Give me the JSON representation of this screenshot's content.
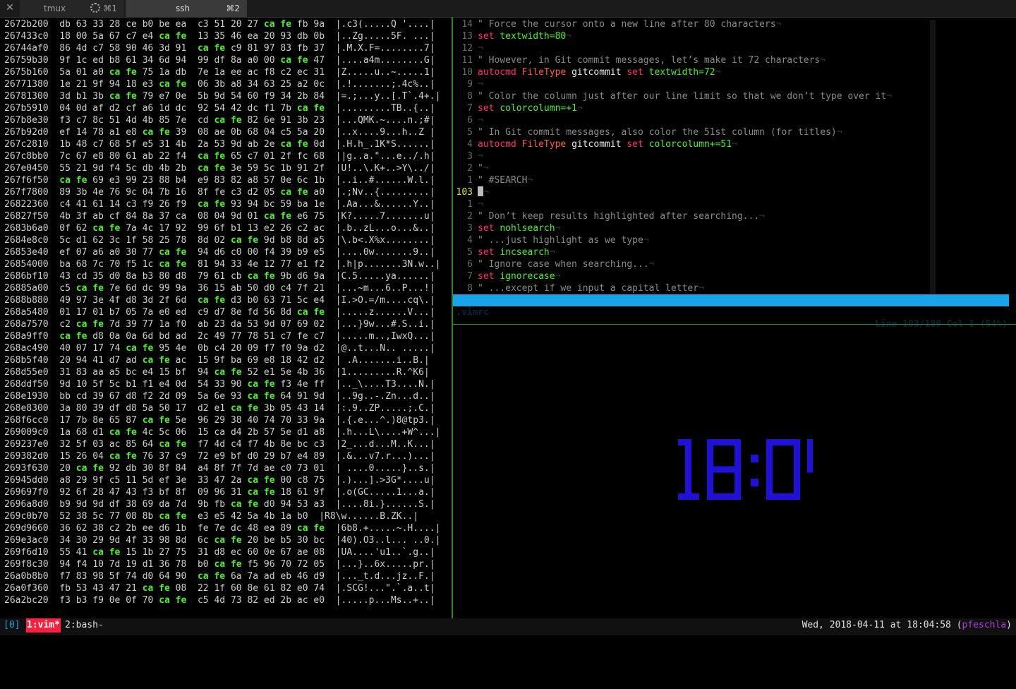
{
  "tabs": [
    {
      "title": "tmux",
      "shortcut": "⌘1",
      "busy": true
    },
    {
      "title": "ssh",
      "shortcut": "⌘2",
      "busy": false
    }
  ],
  "hexdump": [
    {
      "addr": "2672b200",
      "h1": "db 63 33 28 ce b0 be ea",
      "h2": "c3 51 20 27 ca fe fb 9a",
      "ascii": "|.c3(.....Q '....|"
    },
    {
      "addr": "267433c0",
      "h1": "18 00 5a 67 c7 e4 ca fe",
      "h2": "13 35 46 ea 20 93 db 0b",
      "ascii": "|..Zg.....5F. ...|"
    },
    {
      "addr": "26744af0",
      "h1": "86 4d c7 58 90 46 3d 91",
      "h2": "ca fe c9 81 97 83 fb 37",
      "ascii": "|.M.X.F=........7|"
    },
    {
      "addr": "26759b30",
      "h1": "9f 1c ed b8 61 34 6d 94",
      "h2": "99 df 8a a0 00 ca fe 47",
      "ascii": "|....a4m........G|"
    },
    {
      "addr": "2675b160",
      "h1": "5a 01 a0 ca fe 75 1a db",
      "h2": "7e 1a ee ac f8 c2 ec 31",
      "ascii": "|Z.....u..~.....1|"
    },
    {
      "addr": "26771380",
      "h1": "1e 21 9f 94 18 e3 ca fe",
      "h2": "06 3b a8 34 63 25 a2 0c",
      "ascii": "|.!.......;.4c%..|"
    },
    {
      "addr": "26781300",
      "h1": "3d b1 3b ca fe 79 e7 0e",
      "h2": "5b 9d 54 60 f9 34 2b 84",
      "ascii": "|=.;...y..[.T`.4+.|"
    },
    {
      "addr": "267b5910",
      "h1": "04 0d af d2 cf a6 1d dc",
      "h2": "92 54 42 dc f1 7b ca fe",
      "ascii": "|.........TB..{..|"
    },
    {
      "addr": "267b8e30",
      "h1": "f3 c7 8c 51 4d 4b 85 7e",
      "h2": "cd ca fe 82 6e 91 3b 23",
      "ascii": "|...QMK.~....n.;#|"
    },
    {
      "addr": "267b92d0",
      "h1": "ef 14 78 a1 e8 ca fe 39",
      "h2": "08 ae 0b 68 04 c5 5a 20",
      "ascii": "|..x....9...h..Z |"
    },
    {
      "addr": "267c2810",
      "h1": "1b 48 c7 68 5f e5 31 4b",
      "h2": "2a 53 9d ab 2e ca fe 0d",
      "ascii": "|.H.h_.1K*S......|"
    },
    {
      "addr": "267c8bb0",
      "h1": "7c 67 e8 80 61 ab 22 f4",
      "h2": "ca fe 65 c7 01 2f fc 68",
      "ascii": "||g..a.\"...e../.h|"
    },
    {
      "addr": "267e0450",
      "h1": "55 21 9d f4 5c db 4b 2b",
      "h2": "ca fe 3e 59 5c 1b 91 2f",
      "ascii": "|U!..\\.K+..>Y\\../|"
    },
    {
      "addr": "267f6f50",
      "h1": "ca fe 69 e3 99 23 88 b4",
      "h2": "e9 83 82 a8 57 0e 6c 1b",
      "ascii": "|..i..#......W.l.|"
    },
    {
      "addr": "267f7800",
      "h1": "89 3b 4e 76 9c 04 7b 16",
      "h2": "8f fe c3 d2 05 ca fe a0",
      "ascii": "|.;Nv..{.........|"
    },
    {
      "addr": "26822360",
      "h1": "c4 41 61 14 c3 f9 26 f9",
      "h2": "ca fe 93 94 bc 59 ba 1e",
      "ascii": "|.Aa...&......Y..|"
    },
    {
      "addr": "26827f50",
      "h1": "4b 3f ab cf 84 8a 37 ca",
      "h2": "08 04 9d 01 ca fe e6 75",
      "ascii": "|K?.....7.......u|"
    },
    {
      "addr": "2683b6a0",
      "h1": "0f 62 ca fe 7a 4c 17 92",
      "h2": "99 6f b1 13 e2 26 c2 ac",
      "ascii": "|.b..zL...o...&..|"
    },
    {
      "addr": "2684e8c0",
      "h1": "5c d1 62 3c 1f 58 25 78",
      "h2": "8d 02 ca fe 9d b8 8d a5",
      "ascii": "|\\.b<.X%x........|"
    },
    {
      "addr": "26853e40",
      "h1": "ef 07 a6 a0 30 77 ca fe",
      "h2": "94 d6 c0 00 f4 39 b9 e5",
      "ascii": "|....0w.......9..|"
    },
    {
      "addr": "26854000",
      "h1": "ba 68 7c 70 f5 1c ca fe",
      "h2": "81 94 33 4e 12 77 e1 f2",
      "ascii": "|.h|p.......3N.w..|"
    },
    {
      "addr": "2686bf10",
      "h1": "43 cd 35 d0 8a b3 80 d8",
      "h2": "79 61 cb ca fe 9b d6 9a",
      "ascii": "|C.5.....ya......|"
    },
    {
      "addr": "26885a00",
      "h1": "c5 ca fe 7e 6d dc 99 9a",
      "h2": "36 15 ab 50 d0 c4 7f 21",
      "ascii": "|...~m...6..P...!|"
    },
    {
      "addr": "2688b880",
      "h1": "49 97 3e 4f d8 3d 2f 6d",
      "h2": "ca fe d3 b0 63 71 5c e4",
      "ascii": "|I.>O.=/m....cq\\.|"
    },
    {
      "addr": "268a5480",
      "h1": "01 17 01 b7 05 7a e0 ed",
      "h2": "c9 d7 8e fd 56 8d ca fe",
      "ascii": "|.....z......V...|"
    },
    {
      "addr": "268a7570",
      "h1": "c2 ca fe 7d 39 77 1a f0",
      "h2": "ab 23 da 53 9d 07 69 02",
      "ascii": "|...}9w...#.S..i.|"
    },
    {
      "addr": "268a9ff0",
      "h1": "ca fe d8 0a 0a 6d bd ad",
      "h2": "2c 49 77 78 51 c7 fe c7",
      "ascii": "|.....m..,IwxQ...|"
    },
    {
      "addr": "268ac490",
      "h1": "40 07 17 74 ca fe 95 4e",
      "h2": "0b c4 20 09 f7 f0 9a d2",
      "ascii": "|@..t...N.. .....|"
    },
    {
      "addr": "268b5f40",
      "h1": "20 94 41 d7 ad ca fe ac",
      "h2": "15 9f ba 69 e8 18 42 d2",
      "ascii": "| .A.......i..B.|"
    },
    {
      "addr": "268d55e0",
      "h1": "31 83 aa a5 bc e4 15 bf",
      "h2": "94 ca fe 52 e1 5e 4b 36",
      "ascii": "|1.........R.^K6|"
    },
    {
      "addr": "268ddf50",
      "h1": "9d 10 5f 5c b1 f1 e4 0d",
      "h2": "54 33 90 ca fe f3 4e ff",
      "ascii": "|.._\\....T3....N.|"
    },
    {
      "addr": "268e1930",
      "h1": "bb cd 39 67 d8 f2 2d 09",
      "h2": "5a 6e 93 ca fe 64 91 9d",
      "ascii": "|..9g..-.Zn...d..|"
    },
    {
      "addr": "268e8300",
      "h1": "3a 80 39 df d8 5a 50 17",
      "h2": "d2 e1 ca fe 3b 05 43 14",
      "ascii": "|:.9..ZP.....;.C.|"
    },
    {
      "addr": "268f6cc0",
      "h1": "17 7b 8e 65 87 ca fe 5e",
      "h2": "96 29 38 40 74 70 33 9a",
      "ascii": "|.{.e...^.)8@tp3.|"
    },
    {
      "addr": "269009c0",
      "h1": "1a 68 d1 ca fe 4c 5c 06",
      "h2": "15 ca d4 2b 57 5e d1 a8",
      "ascii": "|.h...L\\....+W^...|"
    },
    {
      "addr": "269237e0",
      "h1": "32 5f 03 ac 85 64 ca fe",
      "h2": "f7 4d c4 f7 4b 8e bc c3",
      "ascii": "|2_...d...M..K...|"
    },
    {
      "addr": "269382d0",
      "h1": "15 26 04 ca fe 76 37 c9",
      "h2": "72 e9 bf d0 29 b7 e4 89",
      "ascii": "|.&...v7.r...)...|"
    },
    {
      "addr": "2693f630",
      "h1": "20 ca fe 92 db 30 8f 84",
      "h2": "a4 8f 7f 7d ae c0 73 01",
      "ascii": "| ....0.....}..s.|"
    },
    {
      "addr": "26945dd0",
      "h1": "a8 29 9f c5 11 5d ef 3e",
      "h2": "33 47 2a ca fe 00 c8 75",
      "ascii": "|.)...].>3G*....u|"
    },
    {
      "addr": "269697f0",
      "h1": "92 6f 28 47 43 f3 bf 8f",
      "h2": "09 96 31 ca fe 18 61 9f",
      "ascii": "|.o(GC.....1...a.|"
    },
    {
      "addr": "2696a8d0",
      "h1": "b9 9d 9d df 38 69 da 7d",
      "h2": "9b fb ca fe d0 94 53 a3",
      "ascii": "|....8i.}......S.|"
    },
    {
      "addr": "269c0b70",
      "h1": "52 38 5c 77 08 8b ca fe",
      "h2": "e3 e5 42 5a 4b 1a b0",
      "ascii": "|R8\\w......B.ZK..|"
    },
    {
      "addr": "269d9660",
      "h1": "36 62 38 c2 2b ee d6 1b",
      "h2": "fe 7e dc 48 ea 89 ca fe",
      "ascii": "|6b8.+.....~.H....|"
    },
    {
      "addr": "269e3ac0",
      "h1": "34 30 29 9d 4f 33 98 8d",
      "h2": "6c ca fe 20 be b5 30 bc",
      "ascii": "|40).O3..l... ..0.|"
    },
    {
      "addr": "269f6d10",
      "h1": "55 41 ca fe 15 1b 27 75",
      "h2": "31 d8 ec 60 0e 67 ae 08",
      "ascii": "|UA....'u1..`.g..|"
    },
    {
      "addr": "269f8c30",
      "h1": "94 f4 10 7d 19 d1 36 78",
      "h2": "b0 ca fe f5 96 70 72 05",
      "ascii": "|...}..6x.....pr.|"
    },
    {
      "addr": "26a0b8b0",
      "h1": "f7 83 98 5f 74 d0 64 90",
      "h2": "ca fe 6a 7a ad eb 46 d9",
      "ascii": "|..._t.d...jz..F.|"
    },
    {
      "addr": "26a0f360",
      "h1": "fb 53 43 47 21 ca fe 08",
      "h2": "22 1f 60 8e 61 82 e0 74",
      "ascii": "|.SCG!...\".`.a..t|"
    },
    {
      "addr": "26a2bc20",
      "h1": "f3 b3 f9 0e 0f 70 ca fe",
      "h2": "c5 4d 73 82 ed 2b ac e0",
      "ascii": "|.....p...Ms..+..|"
    }
  ],
  "vim": {
    "lines": [
      {
        "n": "14",
        "kind": "comment",
        "text": "\" Force the cursor onto a new line after 80 characters"
      },
      {
        "n": "13",
        "kind": "set",
        "kw": "set",
        "opt": "textwidth=80"
      },
      {
        "n": "12",
        "kind": "blank"
      },
      {
        "n": "11",
        "kind": "comment",
        "text": "\" However, in Git commit messages, let’s make it 72 characters"
      },
      {
        "n": "10",
        "kind": "autocmd",
        "kw": "autocmd",
        "ft": "FileType",
        "name": "gitcommit",
        "kw2": "set",
        "opt": "textwidth=72"
      },
      {
        "n": "9",
        "kind": "blank"
      },
      {
        "n": "8",
        "kind": "comment",
        "text": "\" Color the column just after our line limit so that we don’t type over it"
      },
      {
        "n": "7",
        "kind": "set",
        "kw": "set",
        "opt": "colorcolumn=+1"
      },
      {
        "n": "6",
        "kind": "blank"
      },
      {
        "n": "5",
        "kind": "comment",
        "text": "\" In Git commit messages, also color the 51st column (for titles)"
      },
      {
        "n": "4",
        "kind": "autocmd",
        "kw": "autocmd",
        "ft": "FileType",
        "name": "gitcommit",
        "kw2": "set",
        "opt": "colorcolumn+=51"
      },
      {
        "n": "3",
        "kind": "blank"
      },
      {
        "n": "2",
        "kind": "comment",
        "text": "\""
      },
      {
        "n": "1",
        "kind": "comment",
        "text": "\" #SEARCH"
      },
      {
        "n": "103",
        "kind": "cursor",
        "current": true
      },
      {
        "n": "1",
        "kind": "blank"
      },
      {
        "n": "2",
        "kind": "comment",
        "text": "\" Don’t keep results highlighted after searching..."
      },
      {
        "n": "3",
        "kind": "set",
        "kw": "set",
        "opt": "nohlsearch"
      },
      {
        "n": "4",
        "kind": "comment",
        "text": "\" ...just highlight as we type"
      },
      {
        "n": "5",
        "kind": "set",
        "kw": "set",
        "opt": "incsearch"
      },
      {
        "n": "6",
        "kind": "comment",
        "text": "\" Ignore case when searching..."
      },
      {
        "n": "7",
        "kind": "set",
        "kw": "set",
        "opt": "ignorecase"
      },
      {
        "n": "8",
        "kind": "comment",
        "text": "\" ...except if we input a capital letter"
      }
    ],
    "eol_marker": "¬",
    "status_file": ".vimrc",
    "status_position": "Line 103/189 Col 1 (54%)"
  },
  "clock": {
    "time": "18:04",
    "color": "#1f12d6"
  },
  "statusbar": {
    "session": "[0]",
    "window1": "1:vim*",
    "window2": "2:bash-",
    "datetime": "Wed, 2018-04-11 at 18:04:58",
    "user_open": " (",
    "user": "pfeschla",
    "user_close": ")"
  },
  "colors": {
    "cafe": "#4cf02a",
    "keyword": "#ff2d6f",
    "option": "#4cf02a",
    "filetype": "#ff6030",
    "status_bg": "#1aa3e8",
    "current_window_bg": "#ff2040",
    "user": "#b13ae0"
  }
}
